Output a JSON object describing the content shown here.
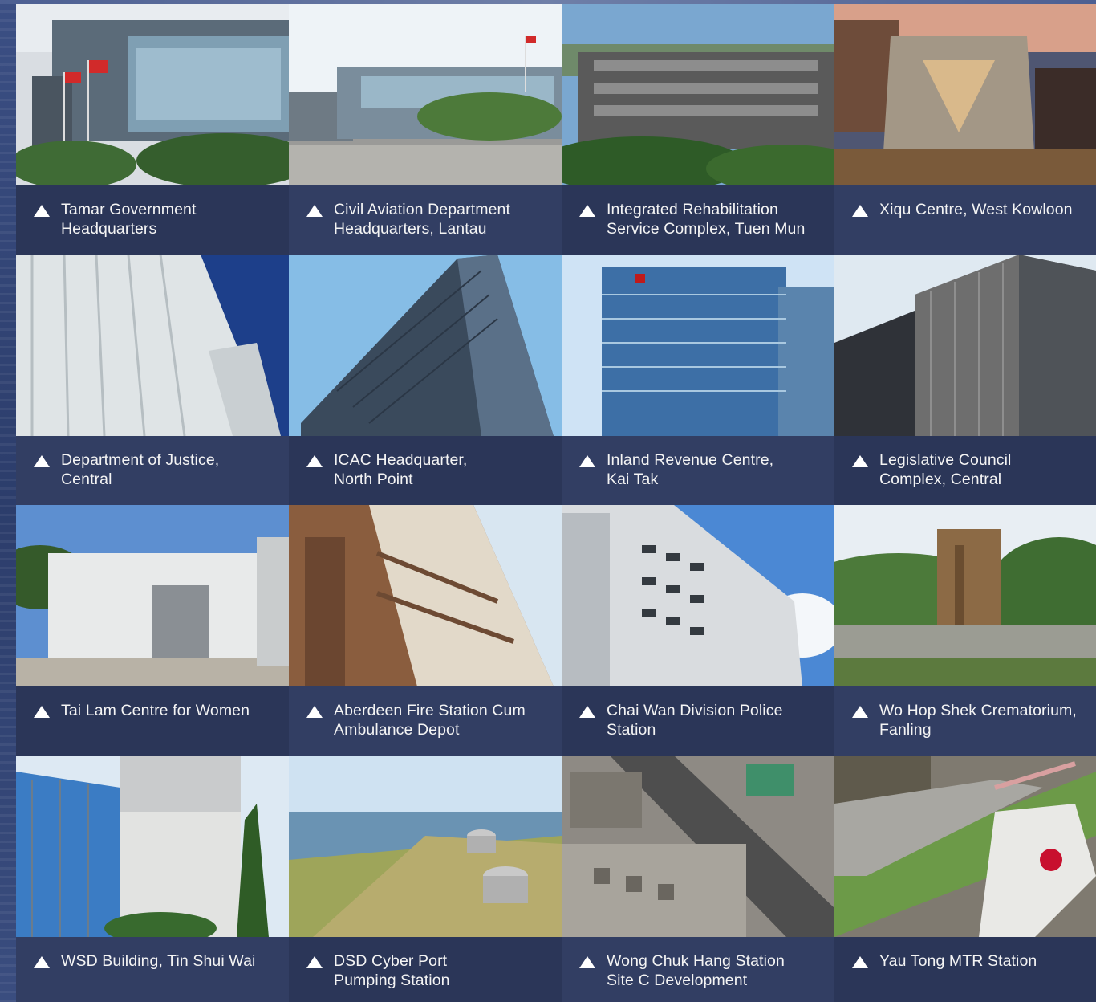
{
  "tiles": [
    {
      "lines": [
        "Tamar Government",
        "Headquarters"
      ],
      "photo": "tamar-government-headquarters-photo"
    },
    {
      "lines": [
        "Civil Aviation Department",
        "Headquarters, Lantau"
      ],
      "photo": "civil-aviation-department-photo"
    },
    {
      "lines": [
        "Integrated Rehabilitation",
        "Service Complex, Tuen Mun"
      ],
      "photo": "integrated-rehabilitation-complex-photo"
    },
    {
      "lines": [
        "Xiqu Centre, West Kowloon"
      ],
      "photo": "xiqu-centre-photo"
    },
    {
      "lines": [
        "Department of Justice,",
        "Central"
      ],
      "photo": "department-of-justice-photo"
    },
    {
      "lines": [
        "ICAC Headquarter,",
        "North Point"
      ],
      "photo": "icac-headquarter-photo"
    },
    {
      "lines": [
        "Inland Revenue Centre,",
        "Kai Tak"
      ],
      "photo": "inland-revenue-centre-photo"
    },
    {
      "lines": [
        "Legislative Council",
        "Complex, Central"
      ],
      "photo": "legislative-council-complex-photo"
    },
    {
      "lines": [
        "Tai Lam Centre for Women"
      ],
      "photo": "tai-lam-centre-photo"
    },
    {
      "lines": [
        "Aberdeen Fire Station Cum",
        "Ambulance Depot"
      ],
      "photo": "aberdeen-fire-station-photo"
    },
    {
      "lines": [
        "Chai Wan Division Police",
        "Station"
      ],
      "photo": "chai-wan-police-station-photo"
    },
    {
      "lines": [
        "Wo Hop Shek Crematorium,",
        "Fanling"
      ],
      "photo": "wo-hop-shek-crematorium-photo"
    },
    {
      "lines": [
        "WSD Building, Tin Shui Wai"
      ],
      "photo": "wsd-building-photo"
    },
    {
      "lines": [
        "DSD Cyber Port",
        "Pumping Station"
      ],
      "photo": "dsd-cyber-port-pumping-station-photo"
    },
    {
      "lines": [
        "Wong Chuk Hang Station",
        "Site C Development"
      ],
      "photo": "wong-chuk-hang-station-photo"
    },
    {
      "lines": [
        "Yau Tong MTR Station"
      ],
      "photo": "yau-tong-mtr-station-photo"
    }
  ],
  "caption_icon": "triangle-up-icon",
  "colors": {
    "caption_bg": "#2b3658",
    "caption_text": "#f4f4f4",
    "background": "#1d2d52"
  }
}
